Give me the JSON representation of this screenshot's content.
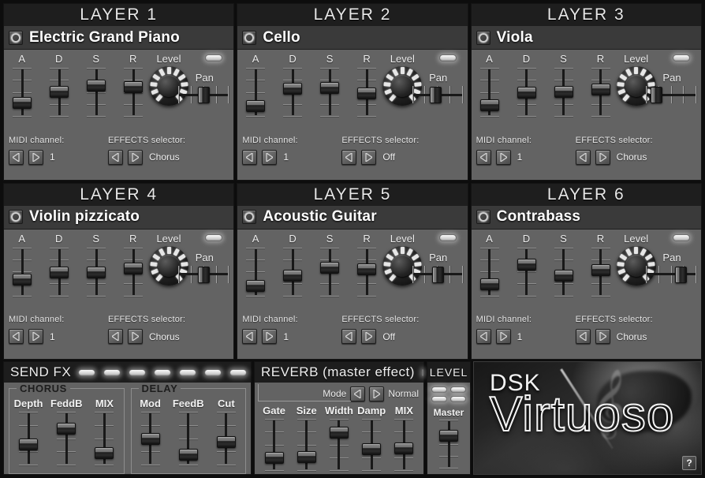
{
  "layers": [
    {
      "title": "LAYER 1",
      "instrument": "Electric Grand Piano",
      "adsr_labels": [
        "A",
        "D",
        "S",
        "R"
      ],
      "adsr": [
        22,
        52,
        68,
        64
      ],
      "level_label": "Level",
      "level": 55,
      "pan_label": "Pan",
      "pan": 50,
      "midi_label": "MIDI channel:",
      "midi_value": "1",
      "effects_label": "EFFECTS selector:",
      "effects_value": "Chorus"
    },
    {
      "title": "LAYER 2",
      "instrument": "Cello",
      "adsr_labels": [
        "A",
        "D",
        "S",
        "R"
      ],
      "adsr": [
        12,
        60,
        62,
        46
      ],
      "level_label": "Level",
      "level": 55,
      "pan_label": "Pan",
      "pan": 44,
      "midi_label": "MIDI channel:",
      "midi_value": "1",
      "effects_label": "EFFECTS selector:",
      "effects_value": "Off"
    },
    {
      "title": "LAYER 3",
      "instrument": "Viola",
      "adsr_labels": [
        "A",
        "D",
        "S",
        "R"
      ],
      "adsr": [
        14,
        48,
        52,
        58
      ],
      "level_label": "Level",
      "level": 55,
      "pan_label": "Pan",
      "pan": 12,
      "midi_label": "MIDI channel:",
      "midi_value": "1",
      "effects_label": "EFFECTS selector:",
      "effects_value": "Chorus"
    },
    {
      "title": "LAYER 4",
      "instrument": "Violin pizzicato",
      "adsr_labels": [
        "A",
        "D",
        "S",
        "R"
      ],
      "adsr": [
        30,
        50,
        48,
        60
      ],
      "level_label": "Level",
      "level": 55,
      "pan_label": "Pan",
      "pan": 50,
      "midi_label": "MIDI channel:",
      "midi_value": "1",
      "effects_label": "EFFECTS selector:",
      "effects_value": "Chorus"
    },
    {
      "title": "LAYER 5",
      "instrument": "Acoustic Guitar",
      "adsr_labels": [
        "A",
        "D",
        "S",
        "R"
      ],
      "adsr": [
        12,
        40,
        62,
        58
      ],
      "level_label": "Level",
      "level": 55,
      "pan_label": "Pan",
      "pan": 52,
      "midi_label": "MIDI channel:",
      "midi_value": "1",
      "effects_label": "EFFECTS selector:",
      "effects_value": "Off"
    },
    {
      "title": "LAYER 6",
      "instrument": "Contrabass",
      "adsr_labels": [
        "A",
        "D",
        "S",
        "R"
      ],
      "adsr": [
        16,
        70,
        40,
        56
      ],
      "level_label": "Level",
      "level": 55,
      "pan_label": "Pan",
      "pan": 76,
      "midi_label": "MIDI channel:",
      "midi_value": "1",
      "effects_label": "EFFECTS selector:",
      "effects_value": "Chorus"
    }
  ],
  "send_fx": {
    "title": "SEND FX",
    "led_count": 7,
    "groups": [
      {
        "name": "CHORUS",
        "sliders": [
          {
            "label": "Depth",
            "value": 36
          },
          {
            "label": "FeddB",
            "value": 74
          },
          {
            "label": "MIX",
            "value": 16
          }
        ]
      },
      {
        "name": "DELAY",
        "sliders": [
          {
            "label": "Mod",
            "value": 50
          },
          {
            "label": "FeedB",
            "value": 12
          },
          {
            "label": "Cut",
            "value": 42
          }
        ]
      }
    ]
  },
  "reverb": {
    "title": "REVERB (master effect)",
    "mode_label": "Mode",
    "mode_value": "Normal",
    "sliders": [
      {
        "label": "Gate",
        "value": 18
      },
      {
        "label": "Size",
        "value": 20
      },
      {
        "label": "Width",
        "value": 80
      },
      {
        "label": "Damp",
        "value": 40
      },
      {
        "label": "MIX",
        "value": 42
      }
    ]
  },
  "level_panel": {
    "title": "LEVEL",
    "led_count": 4,
    "master_label": "Master",
    "master_value": 72
  },
  "logo": {
    "brand": "DSK",
    "product": "Virtuoso",
    "help_label": "?"
  },
  "icons": {
    "arrow_left": "arrow-left-icon",
    "arrow_right": "arrow-right-icon",
    "power": "power-icon"
  },
  "colors": {
    "panel_bg": "#636363",
    "header_bg": "#1d1d1d",
    "led": "#fafafa",
    "text": "#f0f0f0"
  }
}
